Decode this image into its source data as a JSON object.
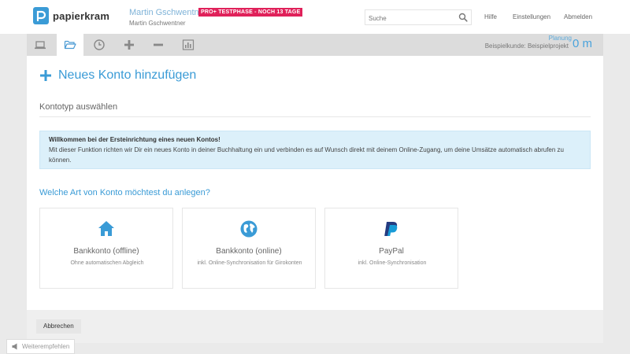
{
  "header": {
    "logo_text": "papierkram",
    "user_name": "Martin Gschwentner",
    "user_sub": "Martin Gschwentner",
    "badge": "PRO+ TESTPHASE - NOCH 13 TAGE",
    "search_placeholder": "Suche",
    "links": {
      "help": "Hilfe",
      "settings": "Einstellungen",
      "logout": "Abmelden"
    }
  },
  "toolbar": {
    "tools": [
      {
        "icon": "laptop-icon",
        "active": false
      },
      {
        "icon": "folder-open-icon",
        "active": true
      },
      {
        "icon": "clock-icon",
        "active": false
      },
      {
        "icon": "plus-icon",
        "active": false
      },
      {
        "icon": "minus-icon",
        "active": false
      },
      {
        "icon": "bar-chart-icon",
        "active": false
      }
    ],
    "planning_label": "Planung",
    "planning_project": "Beispielkunde: Beispielprojekt",
    "planning_value": "0 m"
  },
  "main": {
    "title": "Neues Konto hinzufügen",
    "section_title": "Kontotyp auswählen",
    "info_title": "Willkommen bei der Ersteinrichtung eines neuen Kontos!",
    "info_text": "Mit dieser Funktion richten wir Dir ein neues Konto in deiner Buchhaltung ein und verbinden es auf Wunsch direkt mit deinem Online-Zugang, um deine Umsätze automatisch abrufen zu können.",
    "question": "Welche Art von Konto möchtest du anlegen?",
    "options": [
      {
        "icon": "bank-icon",
        "title": "Bankkonto (offline)",
        "subtitle": "Ohne automatischen Abgleich"
      },
      {
        "icon": "globe-icon",
        "title": "Bankkonto (online)",
        "subtitle": "inkl. Online-Synchronisation für Girokonten"
      },
      {
        "icon": "paypal-icon",
        "title": "PayPal",
        "subtitle": "inkl. Online-Synchronisation"
      }
    ]
  },
  "footer": {
    "cancel_label": "Abbrechen"
  },
  "recommend_label": "Weiterempfehlen",
  "colors": {
    "accent": "#3a9bd6",
    "badge": "#e0215a",
    "info_bg": "#dcf0fa",
    "paypal_dark": "#253b80",
    "paypal_light": "#179bd7"
  }
}
